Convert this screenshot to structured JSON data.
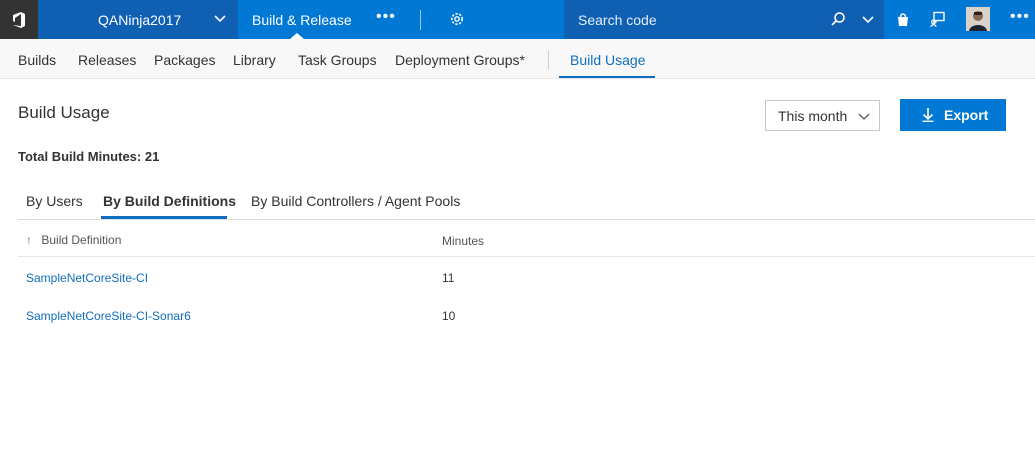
{
  "topbar": {
    "project_name": "QANinja2017",
    "hub_label": "Build & Release",
    "more_label": "•••",
    "search": {
      "placeholder": "Search code"
    },
    "right_more_label": "•••"
  },
  "subnav": {
    "items": [
      {
        "label": "Builds"
      },
      {
        "label": "Releases"
      },
      {
        "label": "Packages"
      },
      {
        "label": "Library"
      },
      {
        "label": "Task Groups"
      },
      {
        "label": "Deployment Groups*"
      },
      {
        "label": "Build Usage"
      }
    ]
  },
  "page": {
    "title": "Build Usage",
    "period": {
      "selected": "This month"
    },
    "export_label": "Export",
    "total_label": "Total Build Minutes: 21"
  },
  "tabs": [
    {
      "label": "By Users"
    },
    {
      "label": "By Build Definitions"
    },
    {
      "label": "By Build Controllers / Agent Pools"
    }
  ],
  "grid": {
    "columns": [
      "Build Definition",
      "Minutes"
    ],
    "rows": [
      {
        "definition": "SampleNetCoreSite-CI",
        "minutes": "11"
      },
      {
        "definition": "SampleNetCoreSite-CI-Sonar6",
        "minutes": "10"
      }
    ]
  },
  "colors": {
    "header_dark": "#0f5fb3",
    "header_accent": "#0078d4",
    "link": "#106ebe"
  }
}
